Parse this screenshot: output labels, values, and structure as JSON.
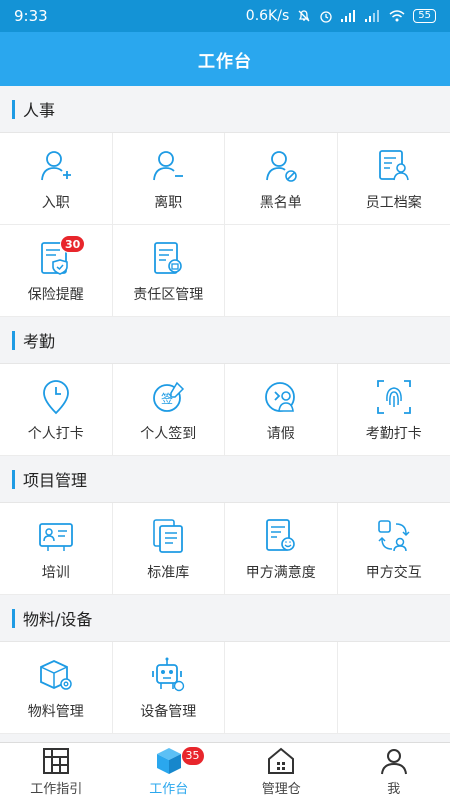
{
  "status_bar": {
    "time": "9:33",
    "network_speed": "0.6K/s",
    "battery": "55"
  },
  "title": "工作台",
  "colors": {
    "primary": "#2aa7ee",
    "icon": "#1e9be4",
    "badge": "#e8262c"
  },
  "sections": {
    "hr": {
      "title": "人事",
      "items": [
        {
          "label": "入职",
          "icon": "user-add-icon"
        },
        {
          "label": "离职",
          "icon": "user-remove-icon"
        },
        {
          "label": "黑名单",
          "icon": "user-block-icon"
        },
        {
          "label": "员工档案",
          "icon": "employee-file-icon"
        },
        {
          "label": "保险提醒",
          "icon": "insurance-icon",
          "badge": "30"
        },
        {
          "label": "责任区管理",
          "icon": "zone-doc-icon"
        }
      ]
    },
    "attendance": {
      "title": "考勤",
      "items": [
        {
          "label": "个人打卡",
          "icon": "location-clock-icon"
        },
        {
          "label": "个人签到",
          "icon": "sign-in-icon"
        },
        {
          "label": "请假",
          "icon": "leave-icon"
        },
        {
          "label": "考勤打卡",
          "icon": "fingerprint-icon"
        }
      ]
    },
    "project": {
      "title": "项目管理",
      "items": [
        {
          "label": "培训",
          "icon": "training-icon"
        },
        {
          "label": "标准库",
          "icon": "standard-library-icon"
        },
        {
          "label": "甲方满意度",
          "icon": "satisfaction-icon"
        },
        {
          "label": "甲方交互",
          "icon": "interaction-icon"
        }
      ]
    },
    "material": {
      "title": "物料/设备",
      "items": [
        {
          "label": "物料管理",
          "icon": "material-box-icon"
        },
        {
          "label": "设备管理",
          "icon": "device-robot-icon"
        }
      ]
    }
  },
  "tabs": [
    {
      "label": "工作指引",
      "icon": "grid-window-icon"
    },
    {
      "label": "工作台",
      "icon": "cube-icon",
      "badge": "35",
      "active": true
    },
    {
      "label": "管理仓",
      "icon": "house-icon"
    },
    {
      "label": "我",
      "icon": "person-icon"
    }
  ]
}
